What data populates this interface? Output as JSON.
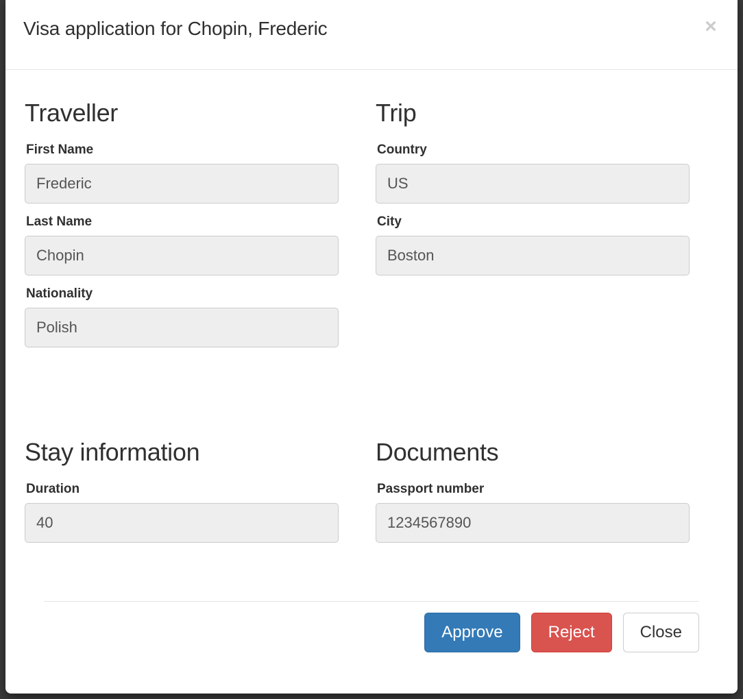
{
  "modal": {
    "title": "Visa application for Chopin, Frederic",
    "close_icon": "×"
  },
  "sections": {
    "traveller": {
      "heading": "Traveller",
      "fields": [
        {
          "label": "First Name",
          "value": "Frederic"
        },
        {
          "label": "Last Name",
          "value": "Chopin"
        },
        {
          "label": "Nationality",
          "value": "Polish"
        }
      ]
    },
    "trip": {
      "heading": "Trip",
      "fields": [
        {
          "label": "Country",
          "value": "US"
        },
        {
          "label": "City",
          "value": "Boston"
        }
      ]
    },
    "stay_information": {
      "heading": "Stay information",
      "fields": [
        {
          "label": "Duration",
          "value": "40"
        }
      ]
    },
    "documents": {
      "heading": "Documents",
      "fields": [
        {
          "label": "Passport number",
          "value": "1234567890"
        }
      ]
    }
  },
  "footer": {
    "approve_label": "Approve",
    "reject_label": "Reject",
    "close_label": "Close"
  },
  "colors": {
    "primary": "#337ab7",
    "danger": "#d9534f",
    "field_bg": "#eeeeee",
    "field_border": "#cccccc",
    "backdrop": "#3a3a3a"
  }
}
